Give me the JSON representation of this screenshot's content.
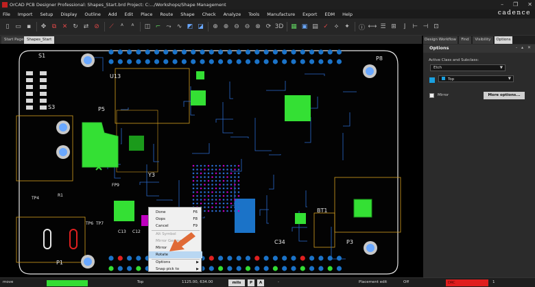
{
  "window": {
    "title": "OrCAD PCB Designer Professional: Shapes_Start.brd  Project: C:.../Workshops/Shape Management",
    "controls": [
      "–",
      "❐",
      "✕"
    ]
  },
  "menubar": {
    "items": [
      "File",
      "Import",
      "Setup",
      "Display",
      "Outline",
      "Add",
      "Edit",
      "Place",
      "Route",
      "Shape",
      "Check",
      "Analyze",
      "Tools",
      "Manufacture",
      "Export",
      "EDM",
      "Help"
    ],
    "brand": "cadence"
  },
  "toolbar": {
    "buttons": [
      {
        "name": "new-icon",
        "glyph": "▯"
      },
      {
        "name": "open-icon",
        "glyph": "▭"
      },
      {
        "name": "save-icon",
        "glyph": "▪"
      },
      {
        "name": "move-icon",
        "glyph": "✥"
      },
      {
        "name": "copy-icon",
        "glyph": "⧉"
      },
      {
        "name": "delete-icon",
        "glyph": "✕"
      },
      {
        "name": "spin-icon",
        "glyph": "↻"
      },
      {
        "name": "mirror-icon",
        "glyph": "⇄"
      },
      {
        "name": "cancel-icon",
        "glyph": "⊘"
      },
      {
        "name": "add-line-icon",
        "glyph": "⟋"
      },
      {
        "name": "add-text-icon",
        "glyph": "ᴬ"
      },
      {
        "name": "change-text-icon",
        "glyph": "ᴬ"
      },
      {
        "name": "padstack-icon",
        "glyph": "◫"
      },
      {
        "name": "connect-icon",
        "glyph": "⌐"
      },
      {
        "name": "slide-icon",
        "glyph": "⤳"
      },
      {
        "name": "delay-tune-icon",
        "glyph": "∿"
      },
      {
        "name": "shape-icon",
        "glyph": "◩"
      },
      {
        "name": "void-icon",
        "glyph": "◪"
      },
      {
        "name": "zoom-fit-icon",
        "glyph": "⊕"
      },
      {
        "name": "zoom-in-icon",
        "glyph": "⊕"
      },
      {
        "name": "zoom-out-icon",
        "glyph": "⊖"
      },
      {
        "name": "zoom-prev-icon",
        "glyph": "⊖"
      },
      {
        "name": "zoom-world-icon",
        "glyph": "⊗"
      },
      {
        "name": "redraw-icon",
        "glyph": "⟳"
      },
      {
        "name": "3d-view-icon",
        "glyph": "3D"
      },
      {
        "name": "grid-icon",
        "glyph": "▦"
      },
      {
        "name": "color-icon",
        "glyph": "▣"
      },
      {
        "name": "layers-icon",
        "glyph": "▤"
      },
      {
        "name": "drc-icon",
        "glyph": "✓"
      },
      {
        "name": "unrats-icon",
        "glyph": "⟡"
      },
      {
        "name": "rats-icon",
        "glyph": "✦"
      },
      {
        "name": "info-icon",
        "glyph": "ⓘ"
      },
      {
        "name": "measure-icon",
        "glyph": "⟷"
      },
      {
        "name": "report-icon",
        "glyph": "☰"
      },
      {
        "name": "calc-icon",
        "glyph": "⊞"
      },
      {
        "name": "route-icon",
        "glyph": "⌋"
      },
      {
        "name": "autoroute-icon",
        "glyph": "⊢"
      },
      {
        "name": "fanout-icon",
        "glyph": "⊣"
      },
      {
        "name": "lock-icon",
        "glyph": "⊡"
      }
    ]
  },
  "doc_tabs": [
    "Start Page",
    "Shapes_Start"
  ],
  "canvas_labels": {
    "s1": "S1",
    "u13": "U13",
    "s3": "S3",
    "p5": "P5",
    "y3": "Y3",
    "fp9": "FP9",
    "tp4": "TP4",
    "c12": "C12",
    "c34": "C34",
    "p3": "P3",
    "p1": "P1",
    "p8": "P8",
    "tp6": "TP6",
    "tp7": "TP7",
    "c13": "C13",
    "r1": "R1",
    "bt1": "BT1"
  },
  "panel": {
    "tabs": [
      "Design Workflow",
      "Find",
      "Visibility",
      "Options"
    ],
    "header": "Options",
    "header_controls": "- ▴ ✕",
    "active_class_label": "Active Class and Subclass:",
    "class_value": "Etch",
    "subclass_value": "Top",
    "subclass_color": "#1aa0e0",
    "mirror_label": "Mirror",
    "more_options": "More options..."
  },
  "context_menu": {
    "items": [
      {
        "label": "Done",
        "key": "F6",
        "disabled": false
      },
      {
        "label": "Oops",
        "key": "F8",
        "disabled": false
      },
      {
        "label": "Cancel",
        "key": "F9",
        "disabled": false
      },
      {
        "label": "Alt Symbol",
        "key": "",
        "disabled": true
      },
      {
        "label": "Mirror Geometry",
        "key": "",
        "disabled": true
      },
      {
        "label": "Mirror",
        "key": "",
        "disabled": false
      },
      {
        "label": "Rotate",
        "key": "",
        "disabled": false,
        "highlighted": true
      },
      {
        "label": "Options",
        "key": "",
        "disabled": false,
        "submenu": true
      },
      {
        "label": "Snap pick to",
        "key": "",
        "disabled": false,
        "submenu": true
      }
    ]
  },
  "statusbar": {
    "command": "move",
    "layer": "Top",
    "coords": "1125.00, 634.00",
    "units": "mils",
    "p_btn": "P",
    "a_btn": "A",
    "hyphen": "-",
    "mode": "Placement edit",
    "state": "Off",
    "drc_label": "DRC",
    "drc_count": "1"
  },
  "colors": {
    "board_outline": "#e8e8e8",
    "pad": "#1b73c8",
    "copper_green": "#34e034",
    "etch_blue": "#2b6bd0",
    "silk_yellow": "#d8a020",
    "accent_orange": "#e06a36",
    "drc_red": "#e01d1d"
  }
}
